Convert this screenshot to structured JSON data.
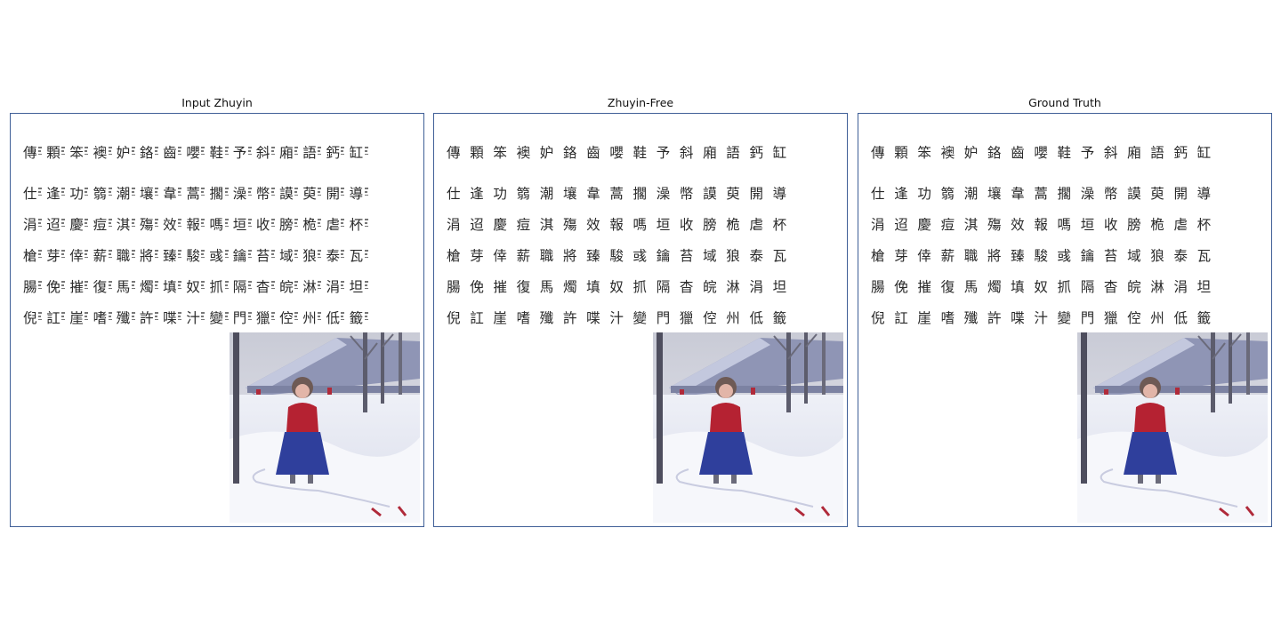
{
  "panels": [
    {
      "title": "Input Zhuyin",
      "zhuyin": true
    },
    {
      "title": "Zhuyin-Free",
      "zhuyin": false
    },
    {
      "title": "Ground Truth",
      "zhuyin": false
    }
  ],
  "rows": [
    "傳顆笨襖妒鉻齒嚶鞋予斜廂語鈣缸",
    "仕逢功篛潮壤韋蒿擱澡幣謨萸開導",
    "涓迢慶痘淇殤效報嗎垣收膀桅虐杯",
    "槍芽倖薪職將臻駿彧鑰苔域狼泰瓦",
    "腸俛摧復馬燭填奴抓隔杳皖淋涓坦",
    "倪訌崖嗜殲許喋汁變門獵倥州低籤"
  ],
  "colors": {
    "frame": "#3f5f97",
    "text": "#2a2a2a",
    "coat": "#b52232",
    "skirt": "#2f3f9c"
  },
  "icons": [
    "girl-in-snow-painting"
  ]
}
